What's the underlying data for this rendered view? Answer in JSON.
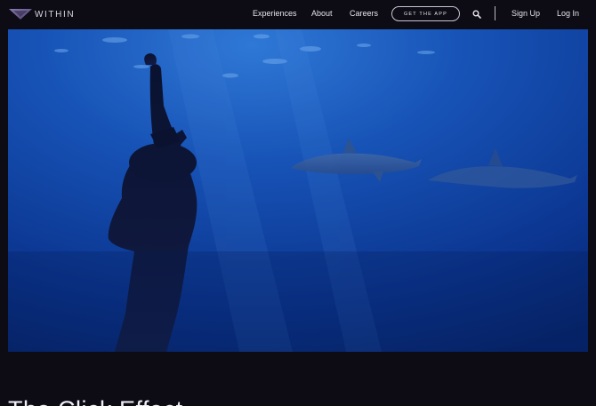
{
  "brand": {
    "name": "WITHIN",
    "logo_icon": "within-triangle-logo-icon",
    "accent_color": "#6b5a8e"
  },
  "nav": {
    "experiences": "Experiences",
    "about": "About",
    "careers": "Careers",
    "get_app": "GET THE APP",
    "search_icon": "search-icon",
    "sign_up": "Sign Up",
    "log_in": "Log In"
  },
  "hero": {
    "image_subject": "underwater freediver with dolphins",
    "colors": {
      "deep_blue": "#0a2f86",
      "light_blue": "#2a6fd0"
    }
  },
  "article": {
    "title": "The Click Effect"
  }
}
